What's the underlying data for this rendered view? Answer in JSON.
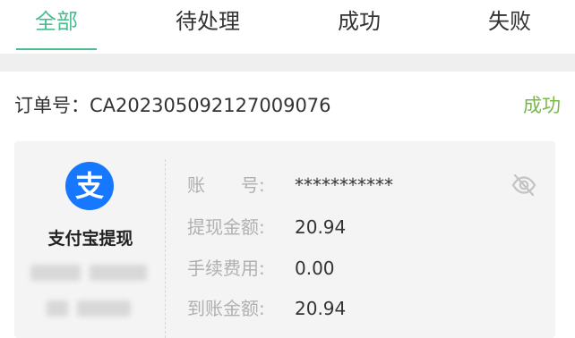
{
  "tabs": [
    {
      "label": "全部",
      "active": true
    },
    {
      "label": "待处理",
      "active": false
    },
    {
      "label": "成功",
      "active": false
    },
    {
      "label": "失败",
      "active": false
    }
  ],
  "order": {
    "number_text": "订单号：CA202305092127009076",
    "status": "成功"
  },
  "method": {
    "name": "支付宝提现",
    "icon": "alipay-icon"
  },
  "details": {
    "account_label": "账　　号:",
    "account_value": "***********",
    "withdraw_label": "提现金额:",
    "withdraw_value": "20.94",
    "fee_label": "手续费用:",
    "fee_value": "0.00",
    "received_label": "到账金额:",
    "received_value": "20.94"
  },
  "colors": {
    "accent": "#4bbd8f",
    "success": "#7bb84a",
    "alipay": "#1677ff"
  }
}
